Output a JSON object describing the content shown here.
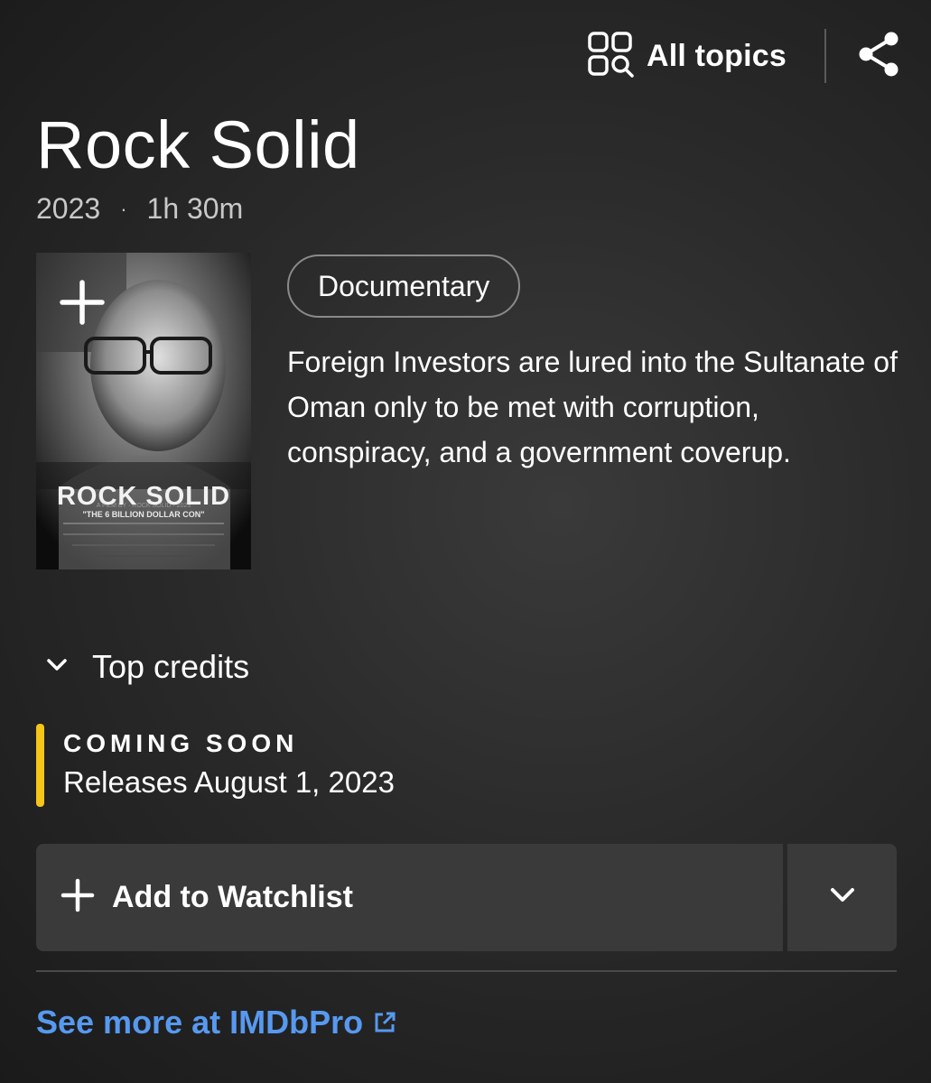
{
  "topbar": {
    "all_topics_label": "All topics"
  },
  "title": "Rock Solid",
  "meta": {
    "year": "2023",
    "runtime": "1h 30m"
  },
  "poster": {
    "title_text": "ROCK SOLID",
    "tagline": "\"THE 6 BILLION DOLLAR CON\""
  },
  "genres": [
    "Documentary"
  ],
  "plot": "Foreign Investors are lured into the Sultanate of Oman only to be met with corruption, conspiracy, and a government coverup.",
  "top_credits_label": "Top credits",
  "release": {
    "status": "COMING SOON",
    "date_text": "Releases August 1, 2023",
    "accent": "#f5c518"
  },
  "watchlist": {
    "label": "Add to Watchlist"
  },
  "imdbpro": {
    "label": "See more at IMDbPro",
    "color": "#5799ef"
  }
}
